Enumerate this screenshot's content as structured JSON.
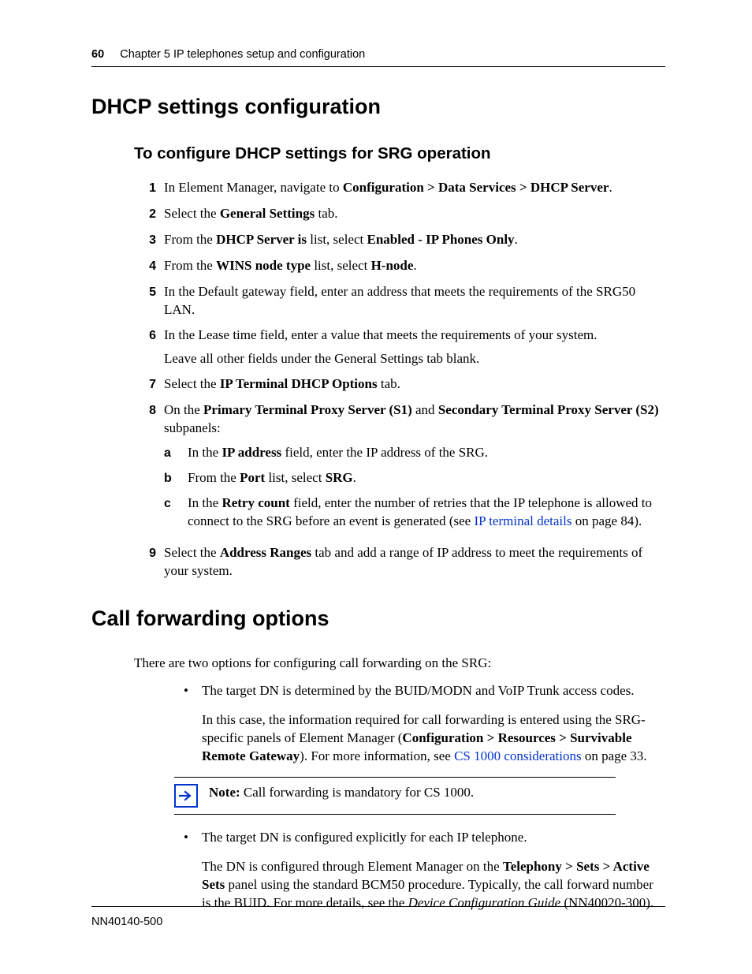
{
  "header": {
    "page_number": "60",
    "chapter_line": "Chapter 5  IP telephones setup and configuration"
  },
  "section1": {
    "title": "DHCP settings configuration",
    "subtitle": "To configure DHCP settings for SRG operation",
    "steps": {
      "s1": {
        "num": "1",
        "pre": "In Element Manager, navigate to ",
        "b": "Configuration > Data Services > DHCP Server",
        "post": "."
      },
      "s2": {
        "num": "2",
        "pre": "Select the ",
        "b": "General Settings",
        "post": " tab."
      },
      "s3": {
        "num": "3",
        "pre": "From the ",
        "b1": "DHCP Server is",
        "mid": " list, select ",
        "b2": "Enabled - IP Phones Only",
        "post": "."
      },
      "s4": {
        "num": "4",
        "pre": "From the ",
        "b1": "WINS node type",
        "mid": " list, select ",
        "b2": "H-node",
        "post": "."
      },
      "s5": {
        "num": "5",
        "text": "In the Default gateway field, enter an address that meets the requirements of the SRG50 LAN."
      },
      "s6": {
        "num": "6",
        "l1": "In the Lease time field, enter a value that meets the requirements of your system.",
        "l2": "Leave all other fields under the General Settings tab blank."
      },
      "s7": {
        "num": "7",
        "pre": "Select the ",
        "b": "IP Terminal DHCP Options",
        "post": " tab."
      },
      "s8": {
        "num": "8",
        "pre": "On the ",
        "b1": "Primary Terminal Proxy Server (S1)",
        "mid": " and ",
        "b2": "Secondary Terminal Proxy Server (S2)",
        "post": " subpanels:",
        "a": {
          "lbl": "a",
          "pre": "In the ",
          "b": "IP address",
          "post": " field, enter the IP address of the SRG."
        },
        "b": {
          "lbl": "b",
          "pre": "From the ",
          "b1": "Port",
          "mid": " list, select ",
          "b2": "SRG",
          "post": "."
        },
        "c": {
          "lbl": "c",
          "pre": "In the ",
          "b": "Retry count",
          "mid": " field, enter the number of retries that the IP telephone is allowed to connect to the SRG before an event is generated (see ",
          "link": "IP terminal details",
          "post": " on page 84)."
        }
      },
      "s9": {
        "num": "9",
        "pre": "Select the ",
        "b": "Address Ranges",
        "post": " tab and add a range of IP address to meet the requirements of your system."
      }
    }
  },
  "section2": {
    "title": "Call forwarding options",
    "intro": "There are two options for configuring call forwarding on the SRG:",
    "bullet1": {
      "line": "The target DN is determined by the BUID/MODN and VoIP Trunk access codes.",
      "para_pre": "In this case, the information required for call forwarding is entered using the SRG-specific panels of Element Manager (",
      "para_b": "Configuration > Resources > Survivable Remote Gateway",
      "para_mid": "). For more information, see ",
      "para_link": "CS 1000 considerations",
      "para_post": " on page 33."
    },
    "note": {
      "label": "Note:",
      "text": " Call forwarding is mandatory for CS 1000."
    },
    "bullet2": {
      "line": "The target DN is configured explicitly for each IP telephone.",
      "para_pre": "The DN is configured through Element Manager on the ",
      "para_b": "Telephony > Sets > Active Sets",
      "para_mid": " panel using the standard BCM50 procedure. Typically, the call forward number is the BUID. For more details, see the ",
      "para_i": "Device Configuration Guide",
      "para_post": " (NN40020-300)."
    }
  },
  "footer": {
    "doc_id": "NN40140-500"
  }
}
